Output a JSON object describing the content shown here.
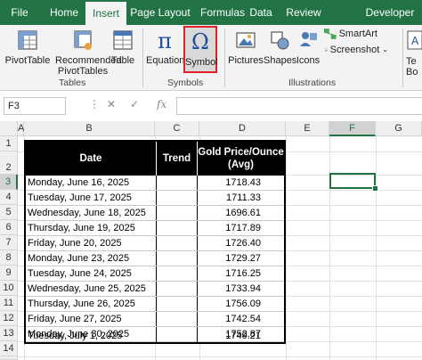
{
  "tabs": [
    "File",
    "Home",
    "Insert",
    "Page Layout",
    "Formulas",
    "Data",
    "Review",
    "Developer"
  ],
  "active_tab": "Insert",
  "ribbon": {
    "pivottable": "PivotTable",
    "recommended_line1": "Recommended",
    "recommended_line2": "PivotTables",
    "table": "Table",
    "tables_group": "Tables",
    "equation": "Equation",
    "symbol": "Symbol",
    "symbols_group": "Symbols",
    "pictures": "Pictures",
    "shapes": "Shapes",
    "icons": "Icons",
    "smartart": "SmartArt",
    "screenshot": "Screenshot",
    "illustrations_group": "Illustrations",
    "textbox_partial_line1": "Te",
    "textbox_partial_line2": "Bo"
  },
  "formula_bar": {
    "name_box": "F3",
    "fx": "fx",
    "formula": ""
  },
  "columns": [
    "A",
    "B",
    "C",
    "D",
    "E",
    "F",
    "G"
  ],
  "selected_column": "F",
  "rows": [
    "1",
    "2",
    "3",
    "4",
    "5",
    "6",
    "7",
    "8",
    "9",
    "10",
    "11",
    "12",
    "13",
    "14",
    "15"
  ],
  "selected_row": "3",
  "table": {
    "headers": {
      "date": "Date",
      "trend": "Trend",
      "price_line1": "Gold Price/Ounce",
      "price_line2": "(Avg)"
    },
    "rows": [
      {
        "date": "Monday, June 16, 2025",
        "trend": "",
        "price": "1718.43"
      },
      {
        "date": "Tuesday, June 17, 2025",
        "trend": "",
        "price": "1711.33"
      },
      {
        "date": "Wednesday, June 18, 2025",
        "trend": "",
        "price": "1696.61"
      },
      {
        "date": "Thursday, June 19, 2025",
        "trend": "",
        "price": "1717.89"
      },
      {
        "date": "Friday, June 20, 2025",
        "trend": "",
        "price": "1726.40"
      },
      {
        "date": "Monday, June 23, 2025",
        "trend": "",
        "price": "1729.27"
      },
      {
        "date": "Tuesday, June 24, 2025",
        "trend": "",
        "price": "1716.25"
      },
      {
        "date": "Wednesday, June 25, 2025",
        "trend": "",
        "price": "1733.94"
      },
      {
        "date": "Thursday, June 26, 2025",
        "trend": "",
        "price": "1756.09"
      },
      {
        "date": "Friday, June 27, 2025",
        "trend": "",
        "price": "1742.54"
      },
      {
        "date": "Monday, June 30, 2025",
        "trend": "",
        "price": "1752.87"
      },
      {
        "date": "Tuesday, July 1, 2025",
        "trend": "",
        "price": "1749.21"
      }
    ]
  },
  "colors": {
    "excel_green": "#217346",
    "highlight_red": "#e0202a",
    "header_black": "#000000"
  }
}
